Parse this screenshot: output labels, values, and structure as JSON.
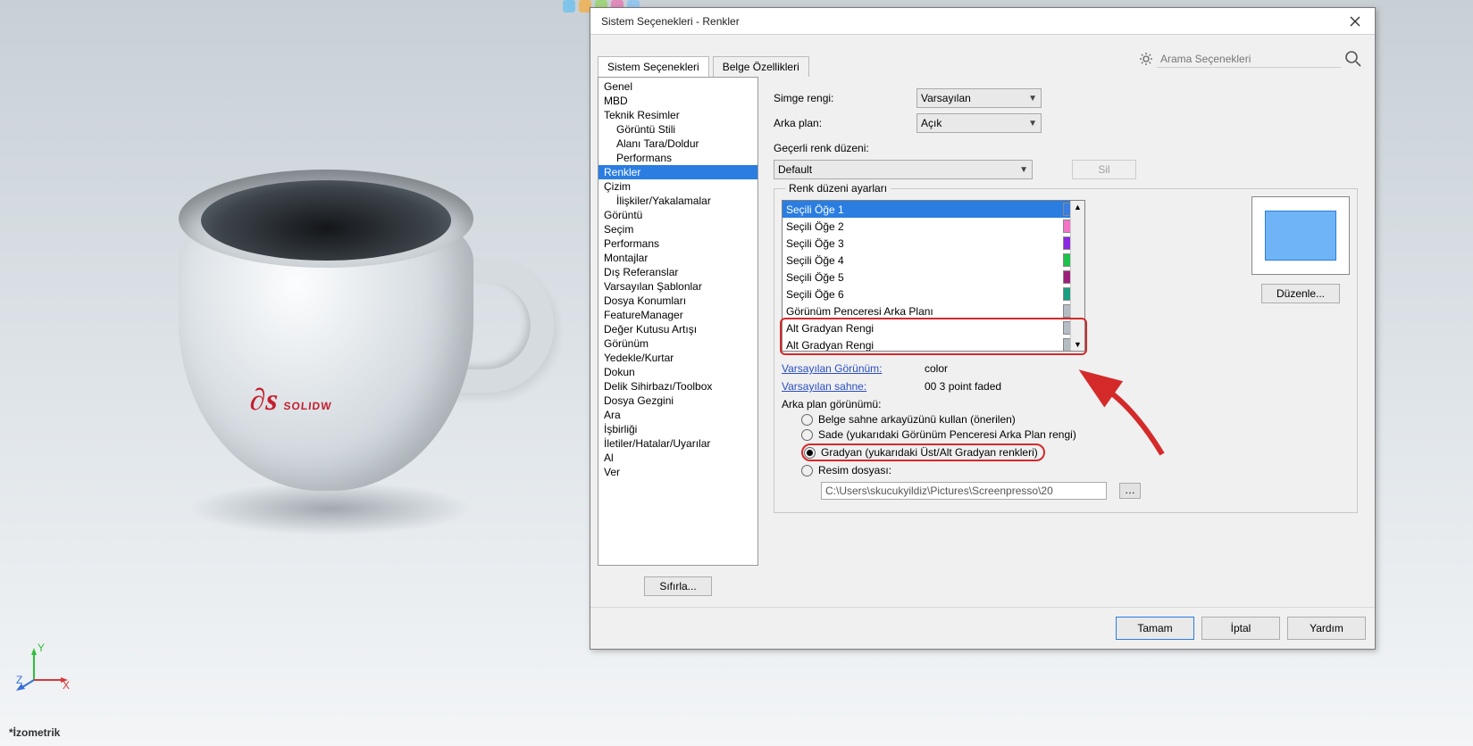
{
  "iso_label": "*İzometrik",
  "brand_text": "SOLIDW",
  "dialog": {
    "title": "Sistem Seçenekleri - Renkler",
    "search_placeholder": "Arama Seçenekleri",
    "tabs": {
      "system": "Sistem Seçenekleri",
      "document": "Belge Özellikleri"
    },
    "tree": {
      "items": [
        {
          "label": "Genel",
          "lvl": 0
        },
        {
          "label": "MBD",
          "lvl": 0
        },
        {
          "label": "Teknik Resimler",
          "lvl": 0
        },
        {
          "label": "Görüntü Stili",
          "lvl": 1
        },
        {
          "label": "Alanı Tara/Doldur",
          "lvl": 1
        },
        {
          "label": "Performans",
          "lvl": 1
        },
        {
          "label": "Renkler",
          "lvl": 0,
          "sel": true
        },
        {
          "label": "Çizim",
          "lvl": 0
        },
        {
          "label": "İlişkiler/Yakalamalar",
          "lvl": 1
        },
        {
          "label": "Görüntü",
          "lvl": 0
        },
        {
          "label": "Seçim",
          "lvl": 0
        },
        {
          "label": "Performans",
          "lvl": 0
        },
        {
          "label": "Montajlar",
          "lvl": 0
        },
        {
          "label": "Dış Referanslar",
          "lvl": 0
        },
        {
          "label": "Varsayılan Şablonlar",
          "lvl": 0
        },
        {
          "label": "Dosya Konumları",
          "lvl": 0
        },
        {
          "label": "FeatureManager",
          "lvl": 0
        },
        {
          "label": "Değer Kutusu Artışı",
          "lvl": 0
        },
        {
          "label": "Görünüm",
          "lvl": 0
        },
        {
          "label": "Yedekle/Kurtar",
          "lvl": 0
        },
        {
          "label": "Dokun",
          "lvl": 0
        },
        {
          "label": "Delik Sihirbazı/Toolbox",
          "lvl": 0
        },
        {
          "label": "Dosya Gezgini",
          "lvl": 0
        },
        {
          "label": "Ara",
          "lvl": 0
        },
        {
          "label": "İşbirliği",
          "lvl": 0
        },
        {
          "label": "İletiler/Hatalar/Uyarılar",
          "lvl": 0
        },
        {
          "label": "Al",
          "lvl": 0
        },
        {
          "label": "Ver",
          "lvl": 0
        }
      ],
      "reset_btn": "Sıfırla..."
    },
    "right": {
      "icon_color_lbl": "Simge rengi:",
      "icon_color_val": "Varsayılan",
      "background_lbl": "Arka plan:",
      "background_val": "Açık",
      "scheme_lbl": "Geçerli renk düzeni:",
      "scheme_val": "Default",
      "delete_btn": "Sil",
      "group_title": "Renk düzeni ayarları",
      "color_items": [
        {
          "name": "Seçili Öğe 1",
          "color": "#3a7de0",
          "sel": true
        },
        {
          "name": "Seçili Öğe 2",
          "color": "#f373c7"
        },
        {
          "name": "Seçili Öğe 3",
          "color": "#8a2be2"
        },
        {
          "name": "Seçili Öğe 4",
          "color": "#1fc24d"
        },
        {
          "name": "Seçili Öğe 5",
          "color": "#9b1f7a"
        },
        {
          "name": "Seçili Öğe 6",
          "color": "#1a9e82"
        },
        {
          "name": "Görünüm Penceresi Arka Planı",
          "color": "#b4bcc4"
        },
        {
          "name": "Alt Gradyan Rengi",
          "color": "#b4bcc4",
          "hl": true
        },
        {
          "name": "Alt Gradyan Rengi",
          "color": "#b4bcc4",
          "hl": true
        }
      ],
      "edit_btn": "Düzenle...",
      "default_appearance_lbl": "Varsayılan Görünüm:",
      "default_appearance_val": "color",
      "default_scene_lbl": "Varsayılan sahne:",
      "default_scene_val": "00 3 point faded",
      "bg_appearance_lbl": "Arka plan görünümü:",
      "radios": {
        "r1": "Belge sahne arkayüzünü kullan (önerilen)",
        "r2": "Sade (yukarıdaki Görünüm Penceresi Arka Plan rengi)",
        "r3": "Gradyan (yukarıdaki Üst/Alt Gradyan renkleri)",
        "r4": "Resim dosyası:"
      },
      "image_path": "C:\\Users\\skucukyildiz\\Pictures\\Screenpresso\\20"
    },
    "footer": {
      "ok": "Tamam",
      "cancel": "İptal",
      "help": "Yardım"
    }
  }
}
